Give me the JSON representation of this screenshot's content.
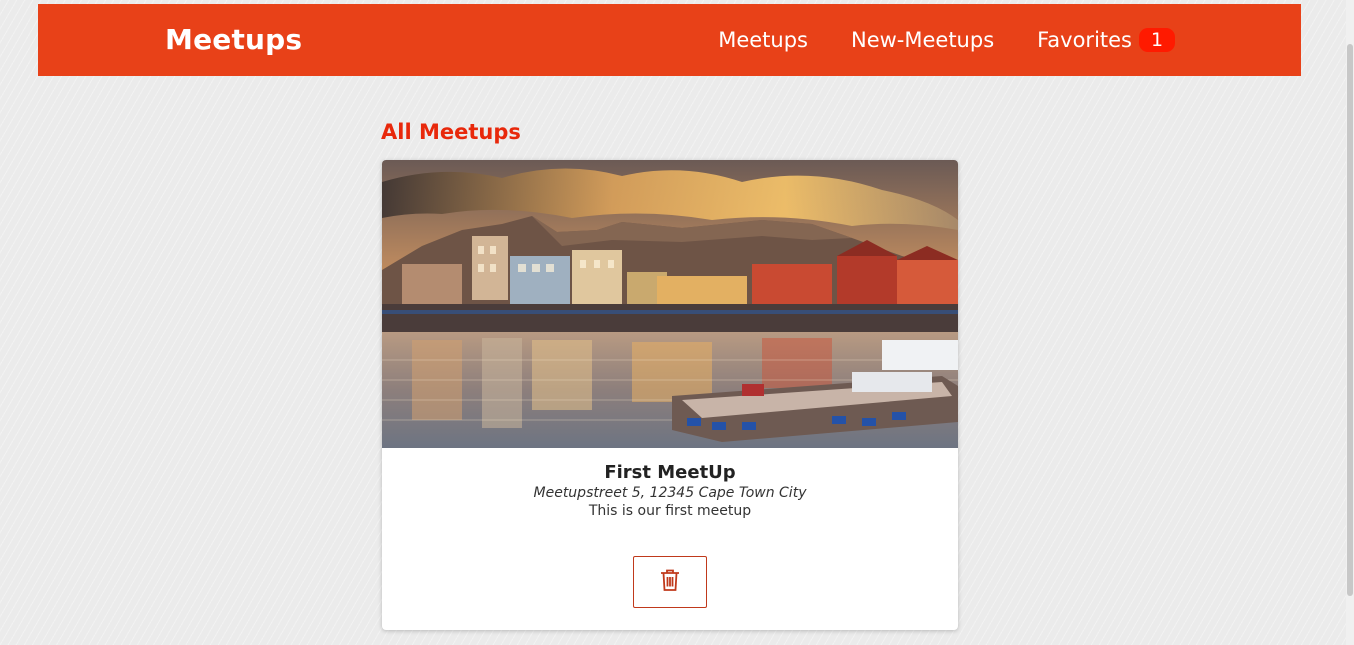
{
  "header": {
    "logo": "Meetups",
    "nav": {
      "meetups": "Meetups",
      "new_meetups": "New-Meetups",
      "favorites": "Favorites",
      "favorites_count": "1"
    }
  },
  "main": {
    "title": "All Meetups",
    "meetups": [
      {
        "title": "First MeetUp",
        "address": "Meetupstreet 5, 12345 Cape Town City",
        "description": "This is our first meetup",
        "image_icon": "harbor-photo",
        "delete_icon": "trash-icon"
      }
    ]
  },
  "colors": {
    "brand": "#e84118",
    "badge": "#ff1a00",
    "title": "#e8280b",
    "background": "#ebebeb"
  }
}
